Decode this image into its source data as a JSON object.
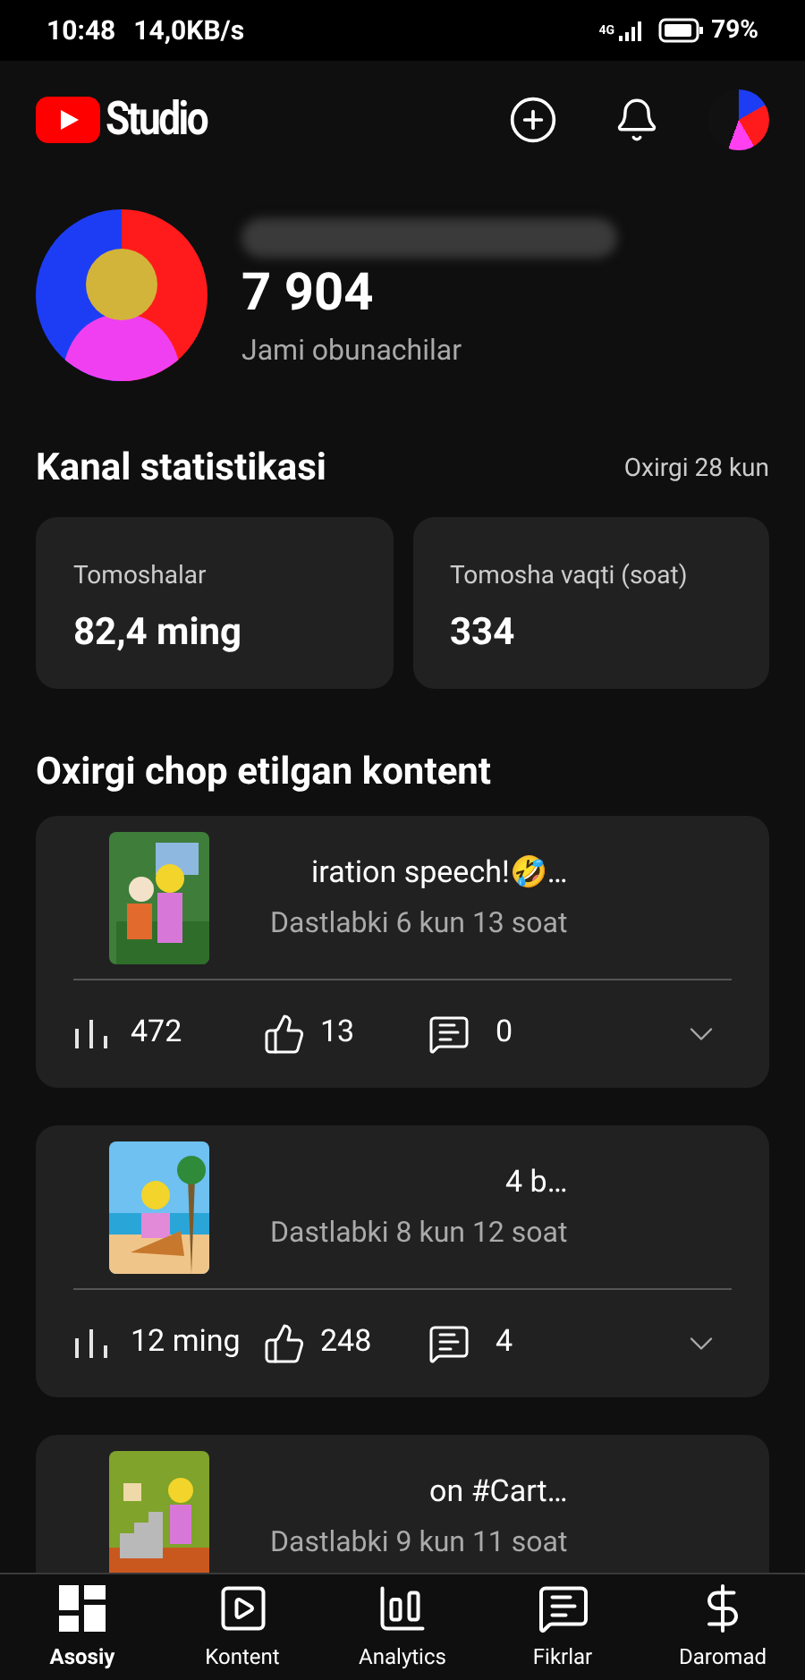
{
  "status_bar": {
    "time": "10:48",
    "speed": "14,0KB/s",
    "network": "4G",
    "battery": "79%"
  },
  "app_bar": {
    "title": "Studio"
  },
  "channel": {
    "subscribers": "7 904",
    "subscribers_label": "Jami obunachilar"
  },
  "stats": {
    "title": "Kanal statistikasi",
    "period": "Oxirgi 28 kun",
    "cards": [
      {
        "label": "Tomoshalar",
        "value": "82,4 ming"
      },
      {
        "label": "Tomosha vaqti (soat)",
        "value": "334"
      }
    ]
  },
  "recent": {
    "title": "Oxirgi chop etilgan kontent",
    "videos": [
      {
        "title": "iration speech!🤣…",
        "age": "Dastlabki 6 kun 13 soat",
        "views": "472",
        "likes": "13",
        "comments": "0"
      },
      {
        "title": "4 b…",
        "age": "Dastlabki 8 kun 12 soat",
        "views": "12 ming",
        "likes": "248",
        "comments": "4"
      },
      {
        "title": "on #Cart…",
        "age": "Dastlabki 9 kun 11 soat"
      }
    ]
  },
  "bottom_nav": [
    {
      "label": "Asosiy",
      "selected": true
    },
    {
      "label": "Kontent",
      "selected": false
    },
    {
      "label": "Analytics",
      "selected": false
    },
    {
      "label": "Fikrlar",
      "selected": false
    },
    {
      "label": "Daromad",
      "selected": false
    }
  ]
}
